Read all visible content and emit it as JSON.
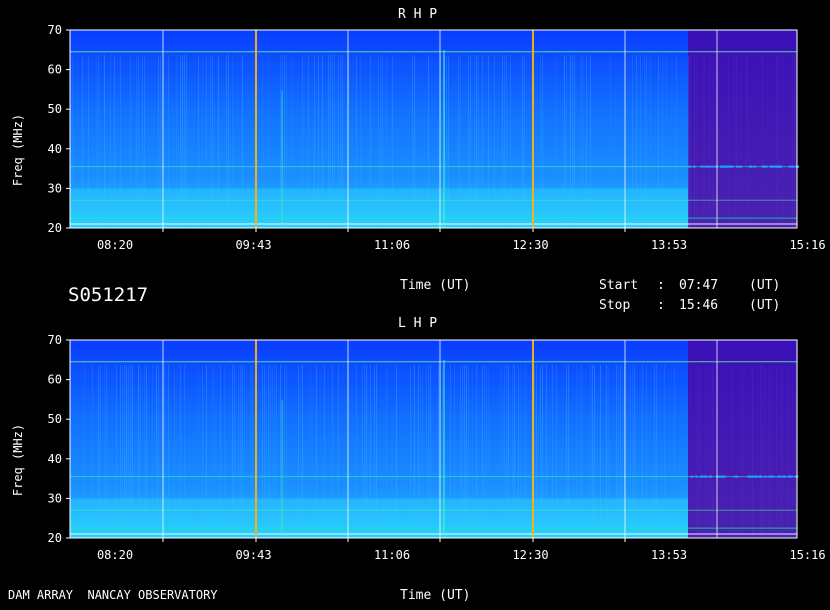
{
  "chart_data": [
    {
      "type": "heatmap",
      "title": "R H P",
      "ylabel": "Freq (MHz)",
      "xlabel": "Time (UT)",
      "ylim": [
        20,
        70
      ],
      "yticks": [
        "20",
        "30",
        "40",
        "50",
        "60",
        "70"
      ],
      "xticks": [
        "08:20",
        "09:43",
        "11:06",
        "12:30",
        "13:53",
        "15:16"
      ],
      "grid": true,
      "events": [
        {
          "time": "09:43",
          "kind": "vertical burst"
        },
        {
          "time": "12:30",
          "kind": "vertical burst"
        }
      ]
    },
    {
      "type": "heatmap",
      "title": "L H P",
      "ylabel": "Freq (MHz)",
      "xlabel": "Time (UT)",
      "ylim": [
        20,
        70
      ],
      "yticks": [
        "20",
        "30",
        "40",
        "50",
        "60",
        "70"
      ],
      "xticks": [
        "08:20",
        "09:43",
        "11:06",
        "12:30",
        "13:53",
        "15:16"
      ],
      "grid": true
    }
  ],
  "info": {
    "id": "S051217",
    "start_label": "Start",
    "stop_label": "Stop",
    "colon": ":",
    "start_time": "07:47",
    "stop_time": "15:46",
    "unit": "(UT)"
  },
  "footer": "DAM ARRAY  NANCAY OBSERVATORY",
  "colors": {
    "background": "#000000",
    "spectrum_low": "#0a3cff",
    "spectrum_mid": "#1aa0ff",
    "spectrum_high": "#00ff80",
    "late_band": "#3a1aa8",
    "gridline": "#ffffff"
  }
}
